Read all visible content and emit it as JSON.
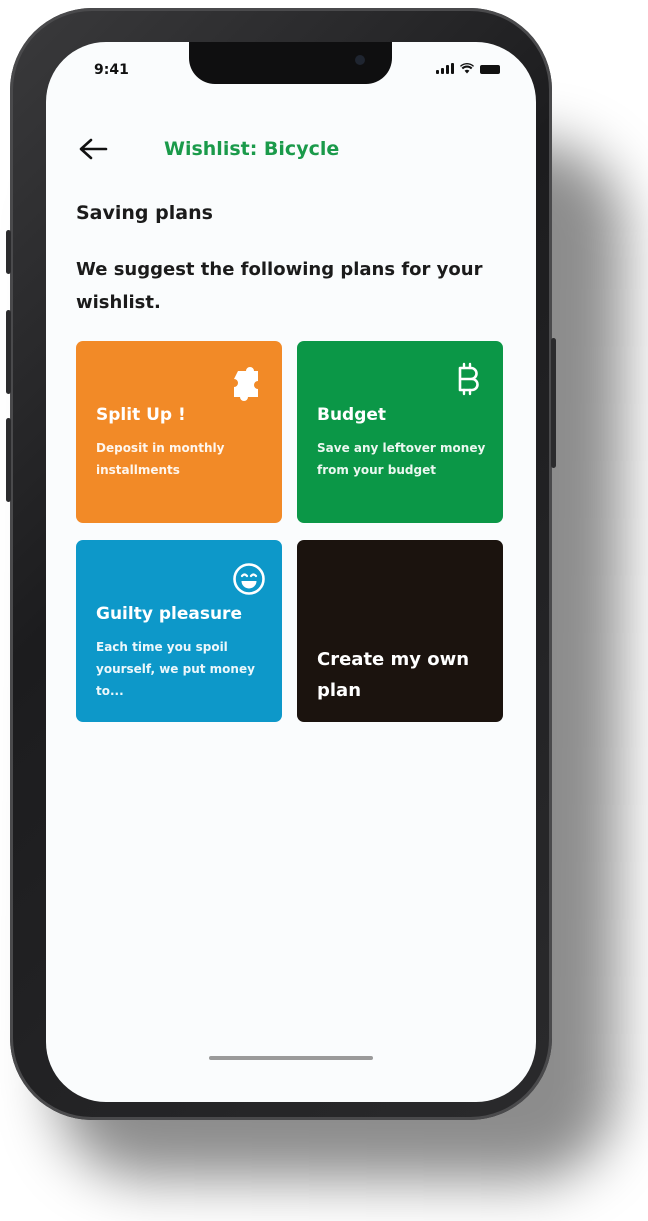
{
  "status_bar": {
    "time": "9:41"
  },
  "header": {
    "back_icon": "arrow-left-icon",
    "title": "Wishlist: Bicycle"
  },
  "section": {
    "title": "Saving plans",
    "intro": "We suggest the following plans for your wishlist."
  },
  "plans": [
    {
      "title": "Split Up !",
      "description": "Deposit in monthly installments",
      "icon": "puzzle-icon",
      "color": "#f28a27"
    },
    {
      "title": "Budget",
      "description": "Save any leftover money from your budget",
      "icon": "bitcoin-b-icon",
      "color": "#0b9747"
    },
    {
      "title": "Guilty pleasure",
      "description": "Each time you spoil yourself, we put money to...",
      "icon": "smiley-icon",
      "color": "#0d98c9"
    },
    {
      "title": "Create my own plan",
      "color": "#1b130e"
    }
  ],
  "colors": {
    "accent": "#1a9a4a",
    "screen_background": "#fafcfd"
  }
}
